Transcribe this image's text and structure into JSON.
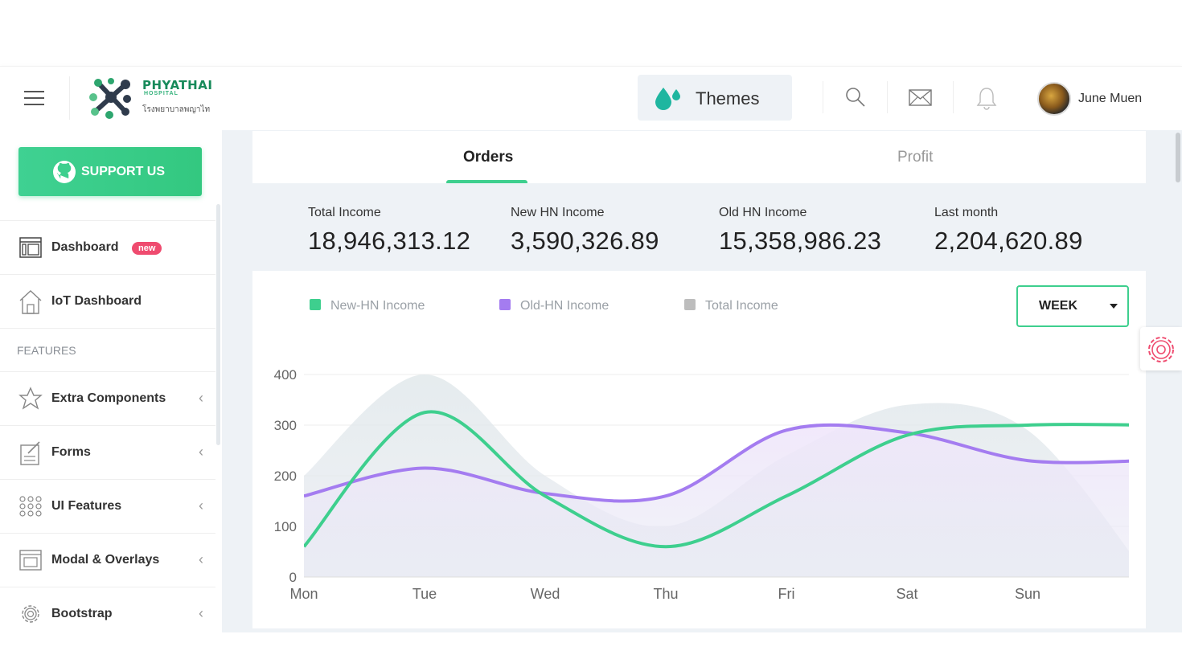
{
  "header": {
    "logo_title": "PHYATHAI",
    "logo_subtitle": "HOSPITAL",
    "logo_thai": "โรงพยาบาลพญาไท",
    "themes_label": "Themes",
    "user_name": "June Muen",
    "icons": [
      "menu-icon",
      "search-icon",
      "mail-icon",
      "bell-icon"
    ]
  },
  "sidebar": {
    "support_label": "SUPPORT US",
    "items_top": [
      {
        "label": "Dashboard",
        "icon": "dashboard-icon",
        "badge": "new"
      },
      {
        "label": "IoT Dashboard",
        "icon": "home-icon"
      }
    ],
    "section_label": "FEATURES",
    "items_features": [
      {
        "label": "Extra Components",
        "icon": "star-icon"
      },
      {
        "label": "Forms",
        "icon": "form-icon"
      },
      {
        "label": "UI Features",
        "icon": "grid-icon"
      },
      {
        "label": "Modal & Overlays",
        "icon": "window-icon"
      },
      {
        "label": "Bootstrap",
        "icon": "gear-icon"
      }
    ]
  },
  "tabs": {
    "orders": "Orders",
    "profit": "Profit",
    "active": "Orders"
  },
  "stats": [
    {
      "label": "Total Income",
      "value": "18,946,313.12"
    },
    {
      "label": "New HN Income",
      "value": "3,590,326.89"
    },
    {
      "label": "Old HN Income",
      "value": "15,358,986.23"
    },
    {
      "label": "Last month",
      "value": "2,204,620.89"
    }
  ],
  "period_select": {
    "value": "WEEK"
  },
  "colors": {
    "accent": "#3ecf8e",
    "purple": "#a47cf0",
    "badge": "#ef4b6f"
  },
  "chart_data": {
    "type": "area",
    "categories": [
      "Mon",
      "Tue",
      "Wed",
      "Thu",
      "Fri",
      "Sat",
      "Sun"
    ],
    "ylim": [
      0,
      400
    ],
    "yticks": [
      0,
      100,
      200,
      300,
      400
    ],
    "legend": "top-left",
    "series": [
      {
        "name": "New-HN Income",
        "color": "#3ecf8e",
        "values": [
          60,
          325,
          160,
          60,
          160,
          280,
          300,
          300
        ]
      },
      {
        "name": "Old-HN Income",
        "color": "#a47cf0",
        "values": [
          160,
          215,
          165,
          160,
          290,
          285,
          230,
          230
        ]
      },
      {
        "name": "Total Income",
        "color": "#bdbdbd",
        "values": [
          200,
          400,
          200,
          100,
          240,
          340,
          290,
          0
        ]
      }
    ]
  }
}
